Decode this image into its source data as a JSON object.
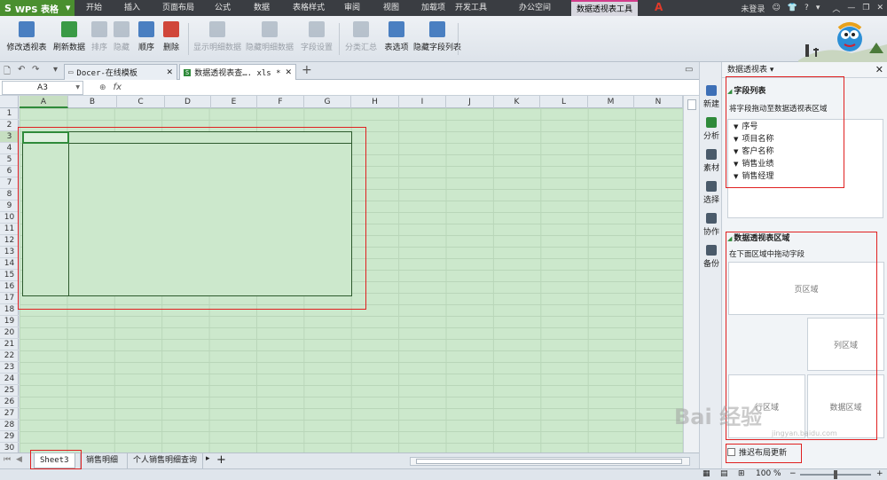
{
  "app": {
    "name": "WPS 表格",
    "logo": "S"
  },
  "menubar": {
    "tabs": [
      "开始",
      "插入",
      "页面布局",
      "公式",
      "数据",
      "表格样式",
      "审阅",
      "视图",
      "加载项",
      "开发工具",
      "办公空间"
    ],
    "active_tab": "数据透视表工具",
    "login": "未登录",
    "help": "?"
  },
  "ribbon": {
    "buttons": [
      {
        "label": "修改透视表",
        "disabled": false,
        "icon": "pivot-edit-icon"
      },
      {
        "label": "刷新数据",
        "disabled": false,
        "icon": "refresh-icon"
      },
      {
        "label": "排序",
        "disabled": true,
        "icon": "sort-icon"
      },
      {
        "label": "隐藏",
        "disabled": true,
        "icon": "hide-icon"
      },
      {
        "label": "顺序",
        "disabled": false,
        "icon": "order-icon"
      },
      {
        "label": "删除",
        "disabled": false,
        "icon": "delete-icon"
      },
      {
        "label": "显示明细数据",
        "disabled": true,
        "icon": "show-detail-icon"
      },
      {
        "label": "隐藏明细数据",
        "disabled": true,
        "icon": "hide-detail-icon"
      },
      {
        "label": "字段设置",
        "disabled": true,
        "icon": "field-settings-icon"
      },
      {
        "label": "分类汇总",
        "disabled": true,
        "icon": "subtotal-icon"
      },
      {
        "label": "表选项",
        "disabled": false,
        "icon": "table-options-icon"
      },
      {
        "label": "隐藏字段列表",
        "disabled": false,
        "icon": "field-list-icon"
      }
    ]
  },
  "doc_tabs": [
    {
      "label": "Docer-在线模板",
      "active": false
    },
    {
      "label": "数据透视表查…. xls *",
      "active": true
    }
  ],
  "formula_bar": {
    "name_box": "A3",
    "fx": "fx"
  },
  "grid": {
    "columns": [
      "A",
      "B",
      "C",
      "D",
      "E",
      "F",
      "G",
      "H",
      "I",
      "J",
      "K",
      "L",
      "M",
      "N"
    ],
    "rows": [
      "1",
      "2",
      "3",
      "4",
      "5",
      "6",
      "7",
      "8",
      "9",
      "10",
      "11",
      "12",
      "13",
      "14",
      "15",
      "16",
      "17",
      "18",
      "19",
      "20",
      "21",
      "22",
      "23",
      "24",
      "25",
      "26",
      "27",
      "28",
      "29",
      "30"
    ],
    "selected_cell": "A3"
  },
  "sheet_tabs": [
    {
      "label": "Sheet3",
      "active": true
    },
    {
      "label": "销售明细",
      "active": false
    },
    {
      "label": "个人销售明细查询",
      "active": false
    }
  ],
  "side_icons": [
    "新建",
    "分析",
    "素材",
    "选择",
    "协作",
    "备份"
  ],
  "pivot_panel": {
    "title": "数据透视表",
    "fields_header": "字段列表",
    "fields_hint": "将字段拖动至数据透视表区域",
    "fields": [
      "序号",
      "项目名称",
      "客户名称",
      "销售业绩",
      "销售经理"
    ],
    "areas_header": "数据透视表区域",
    "areas_hint": "在下面区域中拖动字段",
    "zones": {
      "page": "页区域",
      "column": "列区域",
      "row": "行区域",
      "data": "数据区域"
    },
    "defer_update": "推迟布局更新"
  },
  "status": {
    "zoom": "100 %"
  },
  "watermark": {
    "text": "Bai 经验",
    "sub": "jingyan.baidu.com"
  }
}
